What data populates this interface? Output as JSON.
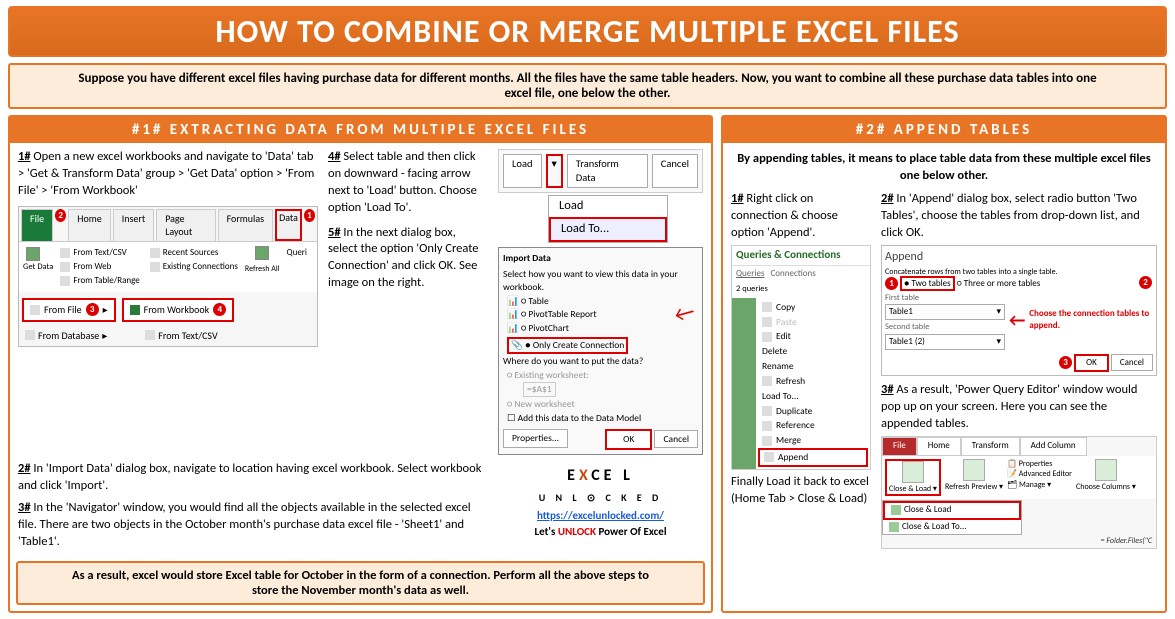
{
  "title": "HOW TO COMBINE OR MERGE MULTIPLE EXCEL FILES",
  "intro": "Suppose you have different excel files having purchase data for different months. All the files have the same table headers. Now, you want to combine all these purchase data tables into one excel file, one below the other.",
  "s1": {
    "header": "#1# EXTRACTING DATA FROM MULTIPLE EXCEL FILES",
    "step1": " Open a new excel workbooks and navigate to 'Data' tab > 'Get & Transform Data' group > 'Get Data' option > 'From File' > 'From Workbook'",
    "step2": " In 'Import Data' dialog box, navigate to location having excel workbook. Select workbook and click 'Import'.",
    "step3": " In the 'Navigator' window, you would find all the objects available in the selected excel file. There are two objects in the October month's purchase data excel file - 'Sheet1' and 'Table1'.",
    "step4": " Select table and then click on downward - facing arrow next to 'Load' button. Choose option 'Load To'.",
    "step5": " In the next dialog box, select the option 'Only Create Connection' and click OK. See image on the right.",
    "result": "As a result, excel would store Excel table for October in the form of a connection. Perform all the above steps to store the November month's data as well."
  },
  "ribbon": {
    "tabs": [
      "File",
      "Home",
      "Insert",
      "Page Layout",
      "Formulas",
      "Data"
    ],
    "getdata": "Get Data",
    "items": [
      "From Text/CSV",
      "From Web",
      "From Table/Range"
    ],
    "recent": "Recent Sources",
    "existing": "Existing Connections",
    "refresh": "Refresh All",
    "queries": "Queri",
    "fromfile": "From File",
    "fromwb": "From Workbook",
    "fromdb": "From Database",
    "fromtxt": "From Text/CSV"
  },
  "load": {
    "load": "Load",
    "transform": "Transform Data",
    "cancel": "Cancel",
    "loadto": "Load To..."
  },
  "impd": {
    "title": "Import Data",
    "sub1": "Select how you want to view this data in your workbook.",
    "opts": [
      "Table",
      "PivotTable Report",
      "PivotChart",
      "Only Create Connection"
    ],
    "sub2": "Where do you want to put the data?",
    "opts2": [
      "Existing worksheet:",
      "New worksheet"
    ],
    "cell": "=$A$1",
    "add": "Add this data to the Data Model",
    "props": "Properties...",
    "ok": "OK",
    "cancel": "Cancel"
  },
  "logo": {
    "link": "https://excelunlocked.com/",
    "tag1": "Let's ",
    "tag2": "UNLOCK",
    "tag3": " Power Of Excel"
  },
  "s2": {
    "header": "#2# APPEND TABLES",
    "intro": "By appending tables, it means to place table data from these multiple excel files one below other.",
    "step1": " Right click on connection & choose option 'Append'.",
    "step2": " In 'Append' dialog box, select radio button 'Two Tables', choose the tables from drop-down list, and click OK.",
    "step3": " As a result, 'Power Query Editor' window would pop up on your screen. Here you can see the appended tables.",
    "final": "Finally Load it back to excel (Home Tab > Close & Load)"
  },
  "qpanel": {
    "head": "Queries & Connections",
    "tabs": [
      "Queries",
      "Connections"
    ],
    "count": "2 queries",
    "items": [
      "Copy",
      "Paste",
      "Edit",
      "Delete",
      "Rename",
      "Refresh",
      "Load To...",
      "Duplicate",
      "Reference",
      "Merge",
      "Append"
    ]
  },
  "append": {
    "title": "Append",
    "sub": "Concatenate rows from two tables into a single table.",
    "r1": "Two tables",
    "r2": "Three or more tables",
    "f1": "First table",
    "f2": "Second table",
    "t1": "Table1",
    "t2": "Table1 (2)",
    "choose": "Choose the connection tables to append.",
    "ok": "OK",
    "cancel": "Cancel"
  },
  "pq": {
    "tabs": [
      "File",
      "Home",
      "Transform",
      "Add Column"
    ],
    "close": "Close & Load",
    "refresh": "Refresh Preview",
    "manage": "Manage",
    "props": "Properties",
    "adv": "Advanced Editor",
    "choose": "Choose Columns",
    "cl": "Close & Load",
    "clto": "Close & Load To...",
    "fx": "= Folder.Files(\"C"
  },
  "nums": {
    "n1": "1#",
    "n2": "2#",
    "n3": "3#",
    "n4": "4#",
    "n5": "5#"
  }
}
